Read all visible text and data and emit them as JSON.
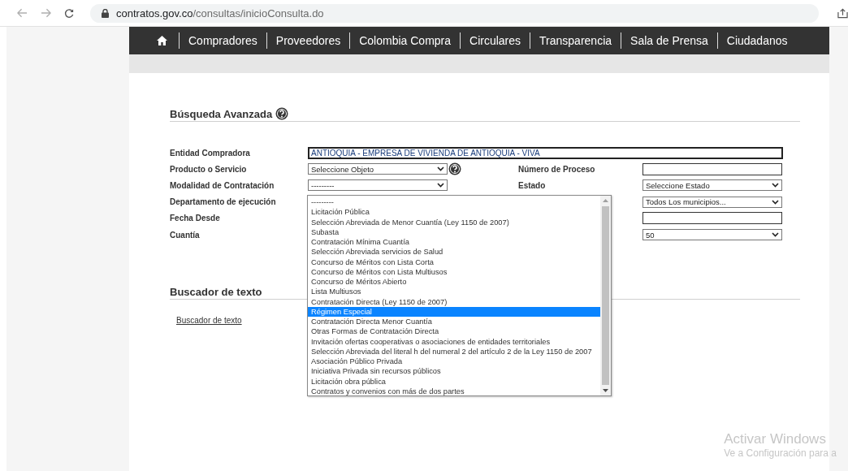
{
  "browser": {
    "url_host": "contratos.gov.co",
    "url_path": "/consultas/inicioConsulta.do"
  },
  "nav": [
    {
      "kind": "home"
    },
    {
      "kind": "link",
      "label": "Compradores"
    },
    {
      "kind": "link",
      "label": "Proveedores"
    },
    {
      "kind": "link",
      "label": "Colombia Compra"
    },
    {
      "kind": "link",
      "label": "Circulares"
    },
    {
      "kind": "link",
      "label": "Transparencia"
    },
    {
      "kind": "link",
      "label": "Sala de Prensa"
    },
    {
      "kind": "link",
      "label": "Ciudadanos"
    }
  ],
  "search": {
    "title": "Búsqueda Avanzada",
    "help": true,
    "rows": [
      {
        "label": "Entidad Compradora",
        "field": {
          "kind": "text",
          "value": "ANTIOQUIA - EMPRESA DE VIVIENDA DE ANTIOQUIA - VIVA",
          "wide": true
        }
      },
      {
        "label": "Producto o Servicio",
        "field": {
          "kind": "select",
          "value": "Seleccione Objeto",
          "help": true
        },
        "label_2": "Número de Proceso",
        "field_2": {
          "kind": "text"
        }
      },
      {
        "label": "Modalidad de Contratación",
        "field": {
          "kind": "select",
          "value": "---------"
        },
        "label_2": "Estado",
        "field_2": {
          "kind": "select",
          "value": "Seleccione Estado"
        }
      },
      {
        "label": "Departamento de ejecución",
        "field_2": {
          "kind": "select",
          "value": "Todos Los municipios..."
        }
      },
      {
        "label": "Fecha Desde",
        "field_2": {
          "kind": "text"
        }
      },
      {
        "label": "Cuantía",
        "field_2": {
          "kind": "select",
          "value": "50"
        }
      }
    ]
  },
  "text_search": {
    "title": "Buscador de texto",
    "link": "Buscador de texto"
  },
  "dropdown": {
    "options": [
      {
        "label": "---------",
        "selected": false
      },
      {
        "label": "Licitación Pública",
        "selected": false
      },
      {
        "label": "Selección Abreviada de Menor Cuantía (Ley 1150 de 2007)",
        "selected": false
      },
      {
        "label": "Subasta",
        "selected": false
      },
      {
        "label": "Contratación Mínima Cuantía",
        "selected": false
      },
      {
        "label": "Selección Abreviada servicios de Salud",
        "selected": false
      },
      {
        "label": "Concurso de Méritos con Lista Corta",
        "selected": false
      },
      {
        "label": "Concurso de Méritos con Lista Multiusos",
        "selected": false
      },
      {
        "label": "Concurso de Méritos Abierto",
        "selected": false
      },
      {
        "label": "Lista Multiusos",
        "selected": false
      },
      {
        "label": "Contratación Directa (Ley 1150 de 2007)",
        "selected": false
      },
      {
        "label": "Régimen Especial",
        "selected": true
      },
      {
        "label": "Contratación Directa Menor Cuantía",
        "selected": false
      },
      {
        "label": "Otras Formas de Contratación Directa",
        "selected": false
      },
      {
        "label": "Invitación ofertas cooperativas o asociaciones de entidades territoriales",
        "selected": false
      },
      {
        "label": "Selección Abreviada del literal h del numeral 2 del artículo 2 de la Ley 1150 de 2007",
        "selected": false
      },
      {
        "label": "Asociación Público Privada",
        "selected": false
      },
      {
        "label": "Iniciativa Privada sin recursos públicos",
        "selected": false
      },
      {
        "label": "Licitación obra pública",
        "selected": false
      },
      {
        "label": "Contratos y convenios con más de dos partes",
        "selected": false
      }
    ]
  },
  "os_notice": {
    "title": "Activar Windows",
    "text": "Ve a Configuración para a"
  }
}
